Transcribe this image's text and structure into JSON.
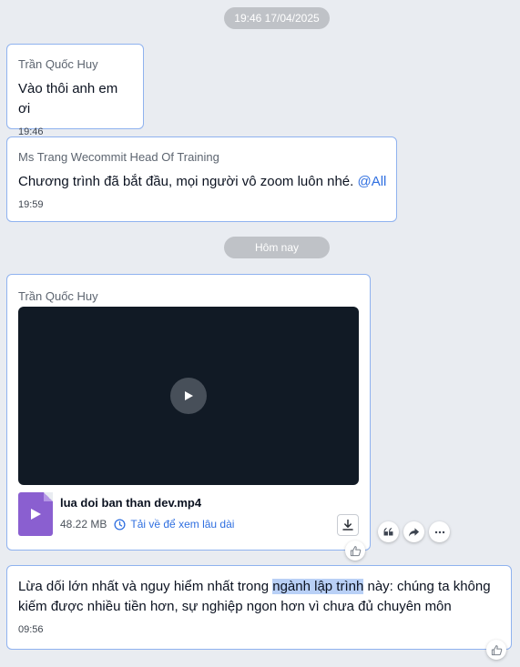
{
  "separators": {
    "date_time": "19:46 17/04/2025",
    "today": "Hôm nay"
  },
  "messages": [
    {
      "sender": "Trần Quốc Huy",
      "text": "Vào thôi anh em ơi",
      "time": "19:46"
    },
    {
      "sender": "Ms Trang Wecommit Head Of Training",
      "text": "Chương trình đã bắt đầu, mọi người vô zoom luôn nhé.",
      "mention": "@All",
      "time": "19:59"
    },
    {
      "sender": "Trần Quốc Huy",
      "attachment": {
        "file_name": "lua doi ban than dev.mp4",
        "file_size": "48.22 MB",
        "save_label": "Tải về để xem lâu dài"
      }
    },
    {
      "text_before": "Lừa dối lớn nhất và nguy hiểm nhất trong ",
      "text_highlight": "ngành lập trình",
      "text_after": " này: chúng ta không kiếm được nhiều tiền hơn, sự nghiệp ngon hơn vì chưa đủ chuyên môn",
      "time": "09:56"
    }
  ],
  "icons": {
    "play": "play-icon",
    "file": "video-file-icon",
    "clock": "clock-icon",
    "download": "download-icon",
    "like": "thumbs-up-icon",
    "quote": "quote-icon",
    "forward": "forward-icon",
    "more": "more-icon"
  },
  "colors": {
    "background": "#e9ecf1",
    "bubble_border": "#8fb2ef",
    "link": "#2f6fe0",
    "highlight": "#b9d0f6",
    "file_icon": "#8a5fd0",
    "video_bg": "#111a25"
  }
}
